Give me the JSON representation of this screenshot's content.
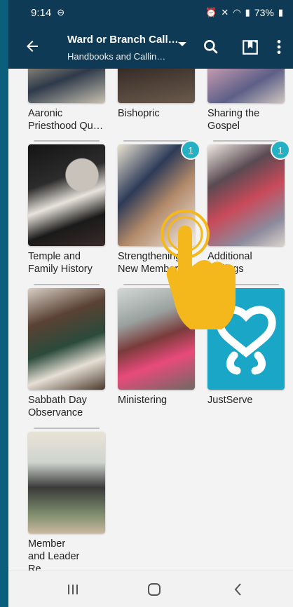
{
  "statusbar": {
    "time": "9:14",
    "battery": "73%"
  },
  "appbar": {
    "title": "Ward or Branch Calli…",
    "subtitle": "Handbooks and Callin…"
  },
  "tiles": [
    {
      "label": "Aaronic\nPriesthood Qu…"
    },
    {
      "label": "Bishopric"
    },
    {
      "label": "Sharing the\nGospel"
    },
    {
      "label": "Temple and\nFamily History"
    },
    {
      "label": "Strengthening\nNew Members",
      "badge": "1"
    },
    {
      "label": "Additional\nCallings",
      "badge": "1"
    },
    {
      "label": "Sabbath Day\nObservance"
    },
    {
      "label": "Ministering"
    },
    {
      "label": "JustServe"
    },
    {
      "label": "Member\nand Leader Re…"
    }
  ],
  "colors": {
    "appbar": "#0f3a55",
    "badge": "#26b0c4",
    "justserve": "#1aa6c6",
    "hand": "#f5b81c"
  }
}
